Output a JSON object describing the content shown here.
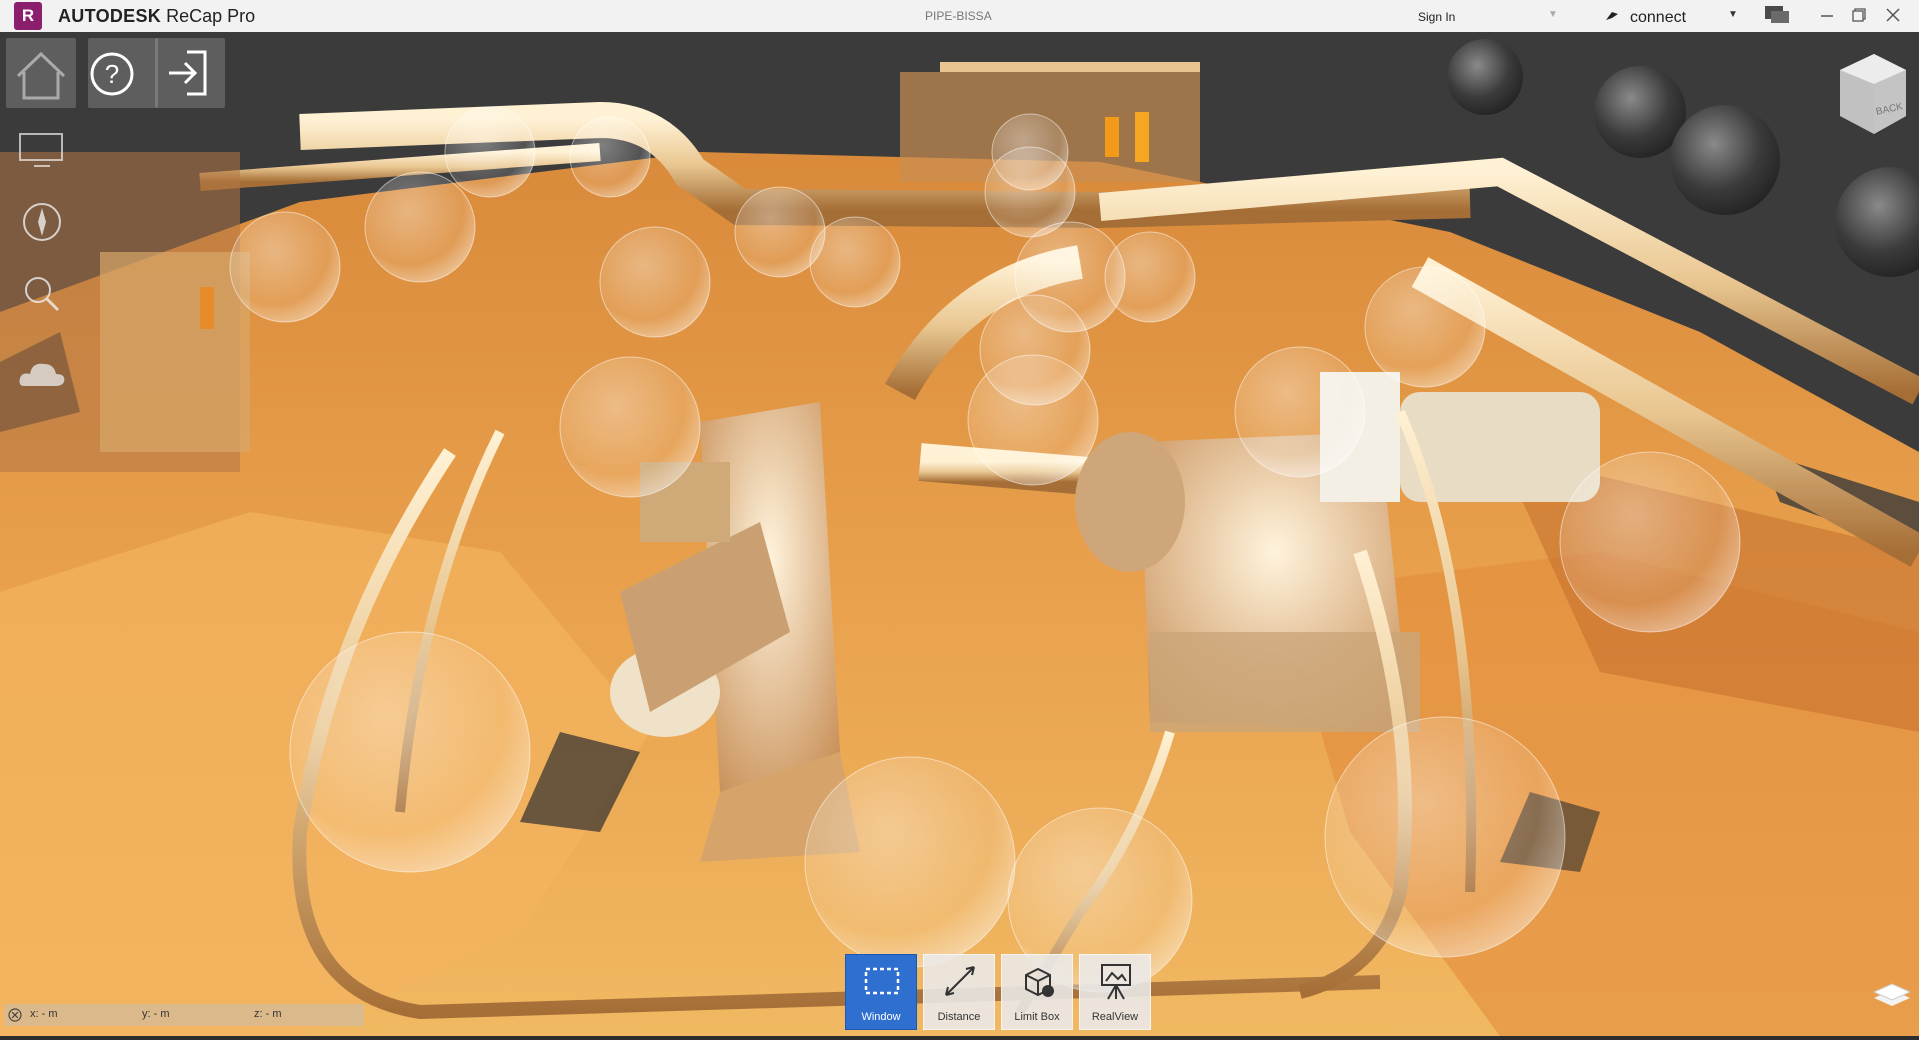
{
  "titlebar": {
    "logo_letter": "R",
    "brand": "AUTODESK",
    "product": "ReCap Pro",
    "document": "PIPE-BISSA",
    "sign_in": "Sign In",
    "connect": "connect"
  },
  "toolbar": {
    "tools": [
      {
        "label": "Window",
        "icon": "window-select-icon",
        "active": true
      },
      {
        "label": "Distance",
        "icon": "distance-icon",
        "active": false
      },
      {
        "label": "Limit Box",
        "icon": "limit-box-icon",
        "active": false
      },
      {
        "label": "RealView",
        "icon": "realview-icon",
        "active": false
      }
    ]
  },
  "coordinates": {
    "x": "x: - m",
    "y": "y: - m",
    "z": "z: - m"
  },
  "viewcube": {
    "face": "BACK"
  },
  "left_tools": [
    "home-icon",
    "help-icon",
    "exit-icon",
    "monitor-icon",
    "orbit-icon",
    "zoom-icon",
    "cloud-icon"
  ],
  "colors": {
    "accent": "#2f6fd0",
    "app_logo": "#8b1f6e",
    "background": "#3b3b3b",
    "pointcloud": "#e8a64a"
  }
}
